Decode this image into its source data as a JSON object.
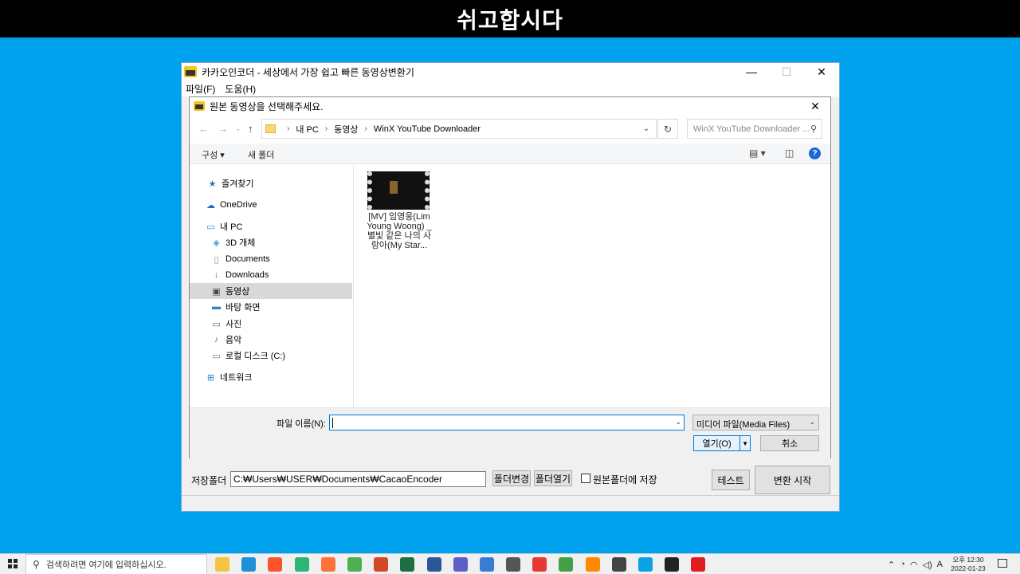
{
  "banner": {
    "text": "쉬고합시다"
  },
  "app": {
    "title": "카카오인코더 - 세상에서 가장 쉽고 빠른 동영상변환기",
    "menu": [
      "파일(F)",
      "도움(H)"
    ],
    "save_label": "저장폴더",
    "save_path": "C:₩Users₩USER₩Documents₩CacaoEncoder",
    "change_folder_button": "폴더변경",
    "open_folder_button": "폴더열기",
    "source_folder_checkbox": "원본폴더에 저장",
    "test_button": "테스트",
    "convert_button": "변환 시작"
  },
  "dialog": {
    "title": "원본 동영상을 선택해주세요.",
    "breadcrumb": [
      "내 PC",
      "동영상",
      "WinX YouTube Downloader"
    ],
    "search_placeholder": "WinX YouTube Downloader ...",
    "toolbar": {
      "organize": "구성 ▾",
      "new_folder": "새 폴더"
    },
    "sidebar": [
      {
        "label": "즐겨찾기",
        "icon": "star-icon"
      },
      {
        "label": "OneDrive",
        "icon": "cloud-icon"
      },
      {
        "label": "내 PC",
        "icon": "computer-icon"
      },
      {
        "label": "3D 개체",
        "icon": "cube-icon"
      },
      {
        "label": "Documents",
        "icon": "document-icon"
      },
      {
        "label": "Downloads",
        "icon": "download-icon"
      },
      {
        "label": "동영상",
        "icon": "video-icon",
        "selected": true
      },
      {
        "label": "바탕 화면",
        "icon": "desktop-icon"
      },
      {
        "label": "사진",
        "icon": "picture-icon"
      },
      {
        "label": "음악",
        "icon": "music-icon"
      },
      {
        "label": "로컬 디스크 (C:)",
        "icon": "drive-icon"
      },
      {
        "label": "네트워크",
        "icon": "network-icon"
      }
    ],
    "file": {
      "name": "[MV] 임영웅(Lim Young Woong) _ 별빛 같은 나의 사랑아(My Star..."
    },
    "filename_label": "파일 이름(N):",
    "filename_value": "",
    "filetype": "미디어 파일(Media Files)",
    "open_button": "열기(O)",
    "cancel_button": "취소"
  },
  "taskbar": {
    "search_placeholder": "검색하려면 여기에 입력하십시오.",
    "time": "오후 12:30",
    "date": "2022-01-23",
    "ime": "A",
    "apps": [
      {
        "name": "file-explorer-icon",
        "color": "#f4c542"
      },
      {
        "name": "edge-icon",
        "color": "#1f8fd8"
      },
      {
        "name": "brave-icon",
        "color": "#fb542b"
      },
      {
        "name": "app-icon",
        "color": "#2bb673"
      },
      {
        "name": "firefox-icon",
        "color": "#ff7139"
      },
      {
        "name": "chrome-icon",
        "color": "#4caf50"
      },
      {
        "name": "powerpoint-icon",
        "color": "#d24726"
      },
      {
        "name": "excel-icon",
        "color": "#1d6f42"
      },
      {
        "name": "word-icon",
        "color": "#2b579a"
      },
      {
        "name": "app-icon",
        "color": "#5b5fc7"
      },
      {
        "name": "app-icon",
        "color": "#3a7bd5"
      },
      {
        "name": "app-icon",
        "color": "#555555"
      },
      {
        "name": "app-icon",
        "color": "#e53935"
      },
      {
        "name": "app-icon",
        "color": "#43a047"
      },
      {
        "name": "vlc-icon",
        "color": "#ff8800"
      },
      {
        "name": "calculator-icon",
        "color": "#444444"
      },
      {
        "name": "app-icon",
        "color": "#0aa3e3"
      },
      {
        "name": "sticky-notes-icon",
        "color": "#222222"
      },
      {
        "name": "opera-icon",
        "color": "#e01b22"
      }
    ]
  }
}
